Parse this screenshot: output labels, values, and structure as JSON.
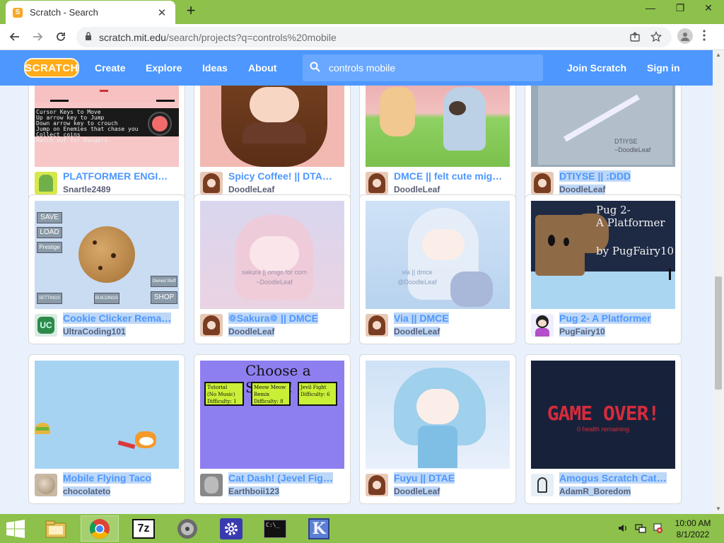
{
  "browser": {
    "tab_title": "Scratch - Search",
    "tab_favicon": "S",
    "tab_close": "✕",
    "new_tab": "+",
    "window_controls": {
      "minimize": "—",
      "restore": "❐",
      "close": "✕"
    },
    "url_host": "scratch.mit.edu",
    "url_path": "/search/projects?q=controls%20mobile",
    "icons": [
      "back-icon",
      "forward-icon",
      "reload-icon",
      "lock-icon",
      "share-icon",
      "bookmark-star-icon",
      "profile-icon",
      "menu-icon"
    ]
  },
  "scratch": {
    "logo": "SCRATCH",
    "nav": {
      "create": "Create",
      "explore": "Explore",
      "ideas": "Ideas",
      "about": "About"
    },
    "search_value": "controls mobile",
    "join": "Join Scratch",
    "signin": "Sign in",
    "colors": {
      "header": "#4d97ff",
      "title": "#4d97ff",
      "author": "#575e75",
      "selection": "#bdd7f7"
    }
  },
  "projects": [
    {
      "title": "PLATFORMER ENGI…",
      "author": "Snartle2489",
      "thumb_text": [
        "Cursor Keys to Move",
        "Up arrow key to Jump",
        "Down arrow key to crouch",
        "Jump on Enemies that chase you",
        "Collect coins",
        "Watch out for Dangers"
      ]
    },
    {
      "title": "Spicy Coffee! || DTA…",
      "author": "DoodleLeaf"
    },
    {
      "title": "DMCE || felt cute mig…",
      "author": "DoodleLeaf"
    },
    {
      "title": "DTIYSE || :DDD",
      "author": "DoodleLeaf",
      "thumb_text": [
        "DTIYSE",
        "~DoodleLeaf"
      ]
    },
    {
      "title": "Cookie Clicker Rema…",
      "author": "UltraCoding101",
      "thumb_text": [
        "SAVE",
        "LOAD",
        "Prestige",
        "Owned Stuff",
        "SETTINGS",
        "BUILDINGS",
        "SHOP"
      ]
    },
    {
      "title": "❁Sakura❁ || DMCE",
      "author": "DoodleLeaf",
      "thumb_text": [
        "sakura || omgo for corn",
        "~DoodleLeaf"
      ]
    },
    {
      "title": "Via || DMCE",
      "author": "DoodleLeaf",
      "thumb_text": [
        "via || dmce",
        "@DoodleLeaf"
      ]
    },
    {
      "title": "Pug 2- A Platformer",
      "author": "PugFairy10",
      "thumb_text": [
        "Pug 2-",
        "A Platformer",
        "by PugFairy10"
      ]
    },
    {
      "title": "Mobile Flying Taco",
      "author": "chocolateto"
    },
    {
      "title": "Cat Dash! (Jevel Fig…",
      "author": "Earthboii123",
      "thumb_text": [
        "Choose a Song!!",
        "Tutorial",
        "(No Music)",
        "Difficulty: 1",
        "Meow Meow",
        "Remix",
        "Difficulty: 8",
        "Jevil Fight",
        "Difficulty: 6"
      ]
    },
    {
      "title": "Fuyu || DTAE",
      "author": "DoodleLeaf"
    },
    {
      "title": "Amogus Scratch Cat…",
      "author": "AdamR_Boredom",
      "thumb_text": [
        "GAME OVER!",
        "0 health remaining"
      ]
    }
  ],
  "taskbar": {
    "apps": [
      "file-explorer-icon",
      "chrome-icon",
      "7zip-icon",
      "media-icon",
      "settings-icon",
      "terminal-icon",
      "k-app-icon"
    ],
    "app_7z": "7z",
    "app_k": "K",
    "terminal_prompt": "C:\\_",
    "time": "10:00 AM",
    "date": "8/1/2022"
  }
}
